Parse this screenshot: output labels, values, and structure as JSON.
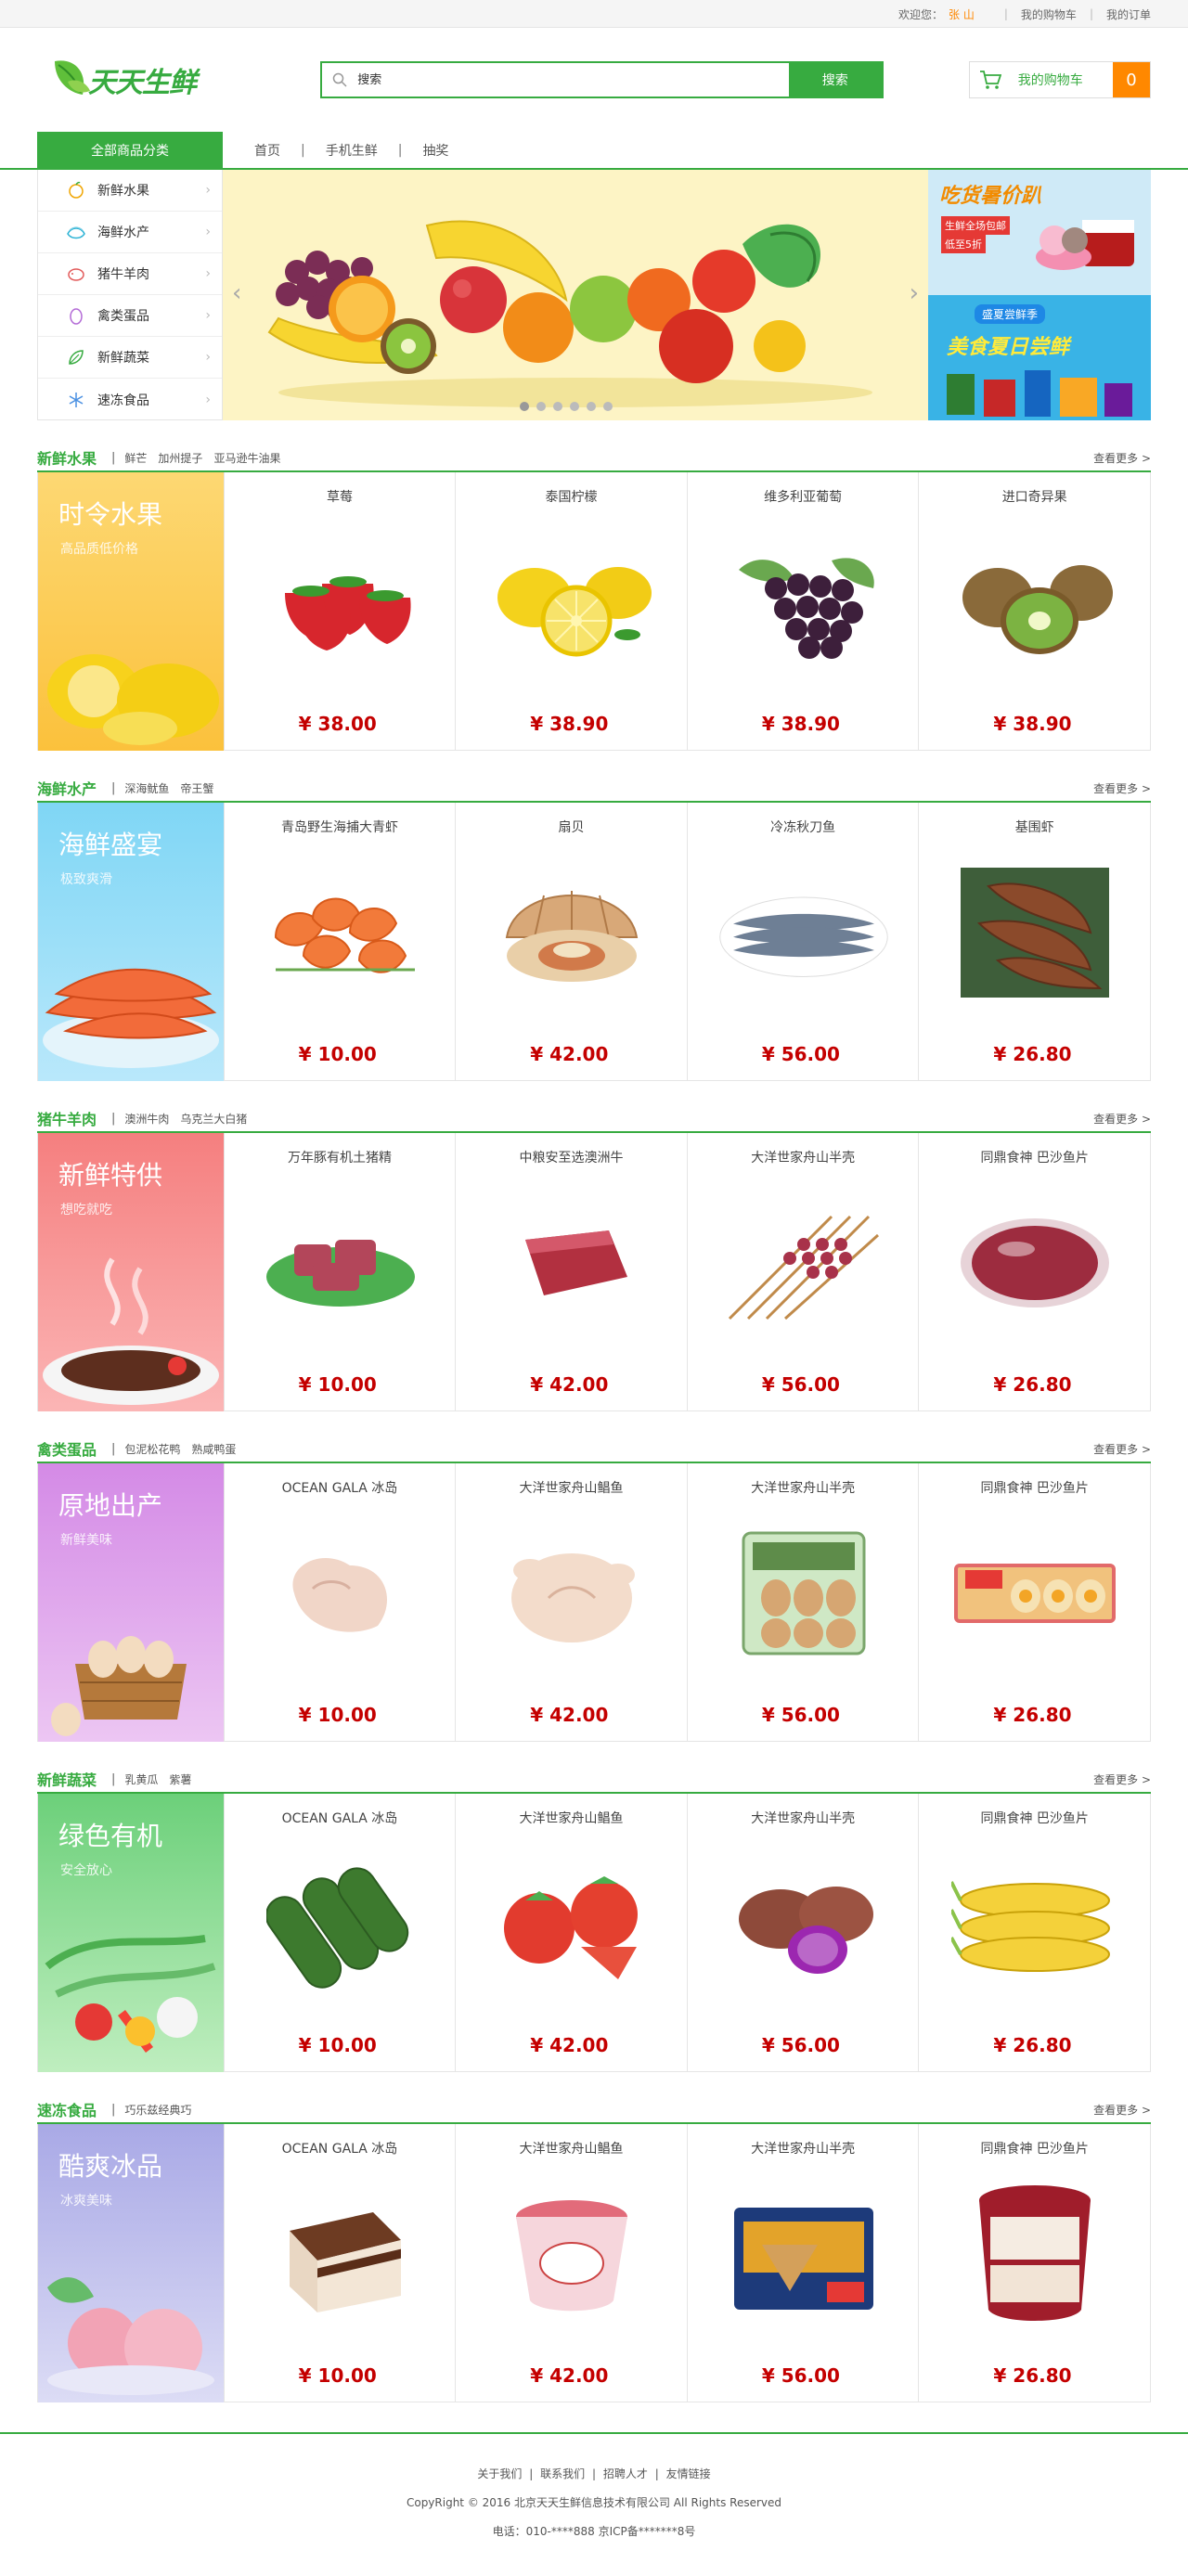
{
  "topbar": {
    "welcome": "欢迎您：",
    "username": "张 山",
    "cart_link": "我的购物车",
    "orders_link": "我的订单"
  },
  "header": {
    "brand": "天天生鲜",
    "search_placeholder": "搜索",
    "search_button": "搜索",
    "cart_label": "我的购物车",
    "cart_count": "0"
  },
  "nav": {
    "all_categories": "全部商品分类",
    "links": [
      "首页",
      "手机生鲜",
      "抽奖"
    ],
    "separator": "|"
  },
  "sidebar": {
    "items": [
      {
        "label": "新鲜水果",
        "icon": "fruit-icon"
      },
      {
        "label": "海鲜水产",
        "icon": "seafood-icon"
      },
      {
        "label": "猪牛羊肉",
        "icon": "meat-icon"
      },
      {
        "label": "禽类蛋品",
        "icon": "egg-icon"
      },
      {
        "label": "新鲜蔬菜",
        "icon": "vegetable-icon"
      },
      {
        "label": "速冻食品",
        "icon": "snowflake-icon"
      }
    ],
    "arrow": "›"
  },
  "banner": {
    "prev": "‹",
    "next": "›",
    "dot_count": 6,
    "active_dot": 0,
    "ad1_title": "吃货暑价趴",
    "ad1_line1": "生鲜全场包邮",
    "ad1_line2": "低至5折",
    "ad2_title": "盛夏尝鲜季",
    "ad2_line": "美食夏日尝鲜"
  },
  "floors": [
    {
      "title": "新鲜水果",
      "subs": [
        "鲜芒",
        "加州提子",
        "亚马逊牛油果"
      ],
      "more": "查看更多 >",
      "banner_title": "时令水果",
      "banner_sub": "高品质低价格",
      "color_top": "#fdd873",
      "color_bottom": "#fbc13c",
      "goods": [
        {
          "name": "草莓",
          "price": "¥ 38.00",
          "img": "strawberry"
        },
        {
          "name": "泰国柠檬",
          "price": "¥ 38.90",
          "img": "lemon"
        },
        {
          "name": "维多利亚葡萄",
          "price": "¥ 38.90",
          "img": "grape"
        },
        {
          "name": "进口奇异果",
          "price": "¥ 38.90",
          "img": "kiwi"
        }
      ]
    },
    {
      "title": "海鲜水产",
      "subs": [
        "深海鱿鱼",
        "帝王蟹"
      ],
      "more": "查看更多 >",
      "banner_title": "海鲜盛宴",
      "banner_sub": "极致爽滑",
      "color_top": "#7fd6f5",
      "color_bottom": "#b9e8fb",
      "goods": [
        {
          "name": "青岛野生海捕大青虾",
          "price": "¥ 10.00",
          "img": "shrimp"
        },
        {
          "name": "扇贝",
          "price": "¥ 42.00",
          "img": "scallop"
        },
        {
          "name": "冷冻秋刀鱼",
          "price": "¥ 56.00",
          "img": "fish"
        },
        {
          "name": "基围虾",
          "price": "¥ 26.80",
          "img": "prawn"
        }
      ]
    },
    {
      "title": "猪牛羊肉",
      "subs": [
        "澳洲牛肉",
        "乌克兰大白猪"
      ],
      "more": "查看更多 >",
      "banner_title": "新鲜特供",
      "banner_sub": "想吃就吃",
      "color_top": "#f57f7f",
      "color_bottom": "#fbb5b5",
      "goods": [
        {
          "name": "万年豚有机土猪精",
          "price": "¥ 10.00",
          "img": "pork"
        },
        {
          "name": "中粮安至选澳洲牛",
          "price": "¥ 42.00",
          "img": "beef"
        },
        {
          "name": "大洋世家舟山半壳",
          "price": "¥ 56.00",
          "img": "skewer"
        },
        {
          "name": "同鼎食神 巴沙鱼片",
          "price": "¥ 26.80",
          "img": "meatpack"
        }
      ]
    },
    {
      "title": "禽类蛋品",
      "subs": [
        "包泥松花鸭",
        "熟咸鸭蛋"
      ],
      "more": "查看更多 >",
      "banner_title": "原地出产",
      "banner_sub": "新鲜美味",
      "color_top": "#d48ae6",
      "color_bottom": "#ecc6f3",
      "goods": [
        {
          "name": "OCEAN GALA 冰岛",
          "price": "¥ 10.00",
          "img": "chicken"
        },
        {
          "name": "大洋世家舟山鲳鱼",
          "price": "¥ 42.00",
          "img": "wholechicken"
        },
        {
          "name": "大洋世家舟山半壳",
          "price": "¥ 56.00",
          "img": "eggbox"
        },
        {
          "name": "同鼎食神 巴沙鱼片",
          "price": "¥ 26.80",
          "img": "eggtray"
        }
      ]
    },
    {
      "title": "新鲜蔬菜",
      "subs": [
        "乳黄瓜",
        "紫薯"
      ],
      "more": "查看更多 >",
      "banner_title": "绿色有机",
      "banner_sub": "安全放心",
      "color_top": "#6cd07a",
      "color_bottom": "#bfeebf",
      "goods": [
        {
          "name": "OCEAN GALA 冰岛",
          "price": "¥ 10.00",
          "img": "cucumber"
        },
        {
          "name": "大洋世家舟山鲳鱼",
          "price": "¥ 42.00",
          "img": "tomato"
        },
        {
          "name": "大洋世家舟山半壳",
          "price": "¥ 56.00",
          "img": "sweetpotato"
        },
        {
          "name": "同鼎食神 巴沙鱼片",
          "price": "¥ 26.80",
          "img": "corn"
        }
      ]
    },
    {
      "title": "速冻食品",
      "subs": [
        "巧乐兹经典巧"
      ],
      "more": "查看更多 >",
      "banner_title": "酷爽冰品",
      "banner_sub": "冰爽美味",
      "color_top": "#a9a9e6",
      "color_bottom": "#dcdcf5",
      "goods": [
        {
          "name": "OCEAN GALA 冰岛",
          "price": "¥ 10.00",
          "img": "cake"
        },
        {
          "name": "大洋世家舟山鲳鱼",
          "price": "¥ 42.00",
          "img": "icecup"
        },
        {
          "name": "大洋世家舟山半壳",
          "price": "¥ 56.00",
          "img": "icebox"
        },
        {
          "name": "同鼎食神 巴沙鱼片",
          "price": "¥ 26.80",
          "img": "haagen"
        }
      ]
    }
  ],
  "footer": {
    "links": [
      "关于我们",
      "联系我们",
      "招聘人才",
      "友情链接"
    ],
    "sep": "|",
    "copyright": "CopyRight © 2016 北京天天生鲜信息技术有限公司 All Rights Reserved",
    "contact": "电话：010-****888    京ICP备*******8号"
  },
  "colors": {
    "brand": "#37ab40",
    "accent": "#ff8800",
    "price": "#c40000"
  }
}
